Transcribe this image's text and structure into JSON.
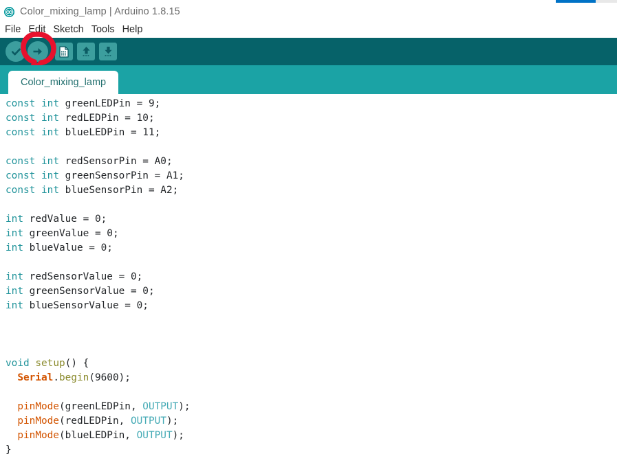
{
  "window": {
    "title": "Color_mixing_lamp | Arduino 1.8.15",
    "logo_icon": "arduino-infinity-icon"
  },
  "menu": {
    "items": [
      {
        "label": "File"
      },
      {
        "label": "Edit"
      },
      {
        "label": "Sketch"
      },
      {
        "label": "Tools"
      },
      {
        "label": "Help"
      }
    ]
  },
  "toolbar": {
    "buttons": [
      {
        "name": "verify",
        "label": "Verify",
        "icon": "check-icon"
      },
      {
        "name": "upload",
        "label": "Upload",
        "icon": "right-arrow-icon"
      },
      {
        "name": "new",
        "label": "New",
        "icon": "document-icon"
      },
      {
        "name": "open",
        "label": "Open",
        "icon": "up-arrow-icon"
      },
      {
        "name": "save",
        "label": "Save",
        "icon": "down-arrow-icon"
      }
    ],
    "annotation": {
      "target": "upload",
      "shape": "hand-drawn-circle",
      "color": "#e8112d"
    }
  },
  "tabs": {
    "active": "Color_mixing_lamp",
    "items": [
      {
        "label": "Color_mixing_lamp",
        "active": true
      }
    ]
  },
  "editor": {
    "lines": [
      [
        {
          "t": "const",
          "c": "kw"
        },
        {
          "t": " ",
          "c": "plain"
        },
        {
          "t": "int",
          "c": "kw"
        },
        {
          "t": " greenLEDPin = 9;",
          "c": "plain"
        }
      ],
      [
        {
          "t": "const",
          "c": "kw"
        },
        {
          "t": " ",
          "c": "plain"
        },
        {
          "t": "int",
          "c": "kw"
        },
        {
          "t": " redLEDPin = 10;",
          "c": "plain"
        }
      ],
      [
        {
          "t": "const",
          "c": "kw"
        },
        {
          "t": " ",
          "c": "plain"
        },
        {
          "t": "int",
          "c": "kw"
        },
        {
          "t": " blueLEDPin = 11;",
          "c": "plain"
        }
      ],
      [],
      [
        {
          "t": "const",
          "c": "kw"
        },
        {
          "t": " ",
          "c": "plain"
        },
        {
          "t": "int",
          "c": "kw"
        },
        {
          "t": " redSensorPin = A0;",
          "c": "plain"
        }
      ],
      [
        {
          "t": "const",
          "c": "kw"
        },
        {
          "t": " ",
          "c": "plain"
        },
        {
          "t": "int",
          "c": "kw"
        },
        {
          "t": " greenSensorPin = A1;",
          "c": "plain"
        }
      ],
      [
        {
          "t": "const",
          "c": "kw"
        },
        {
          "t": " ",
          "c": "plain"
        },
        {
          "t": "int",
          "c": "kw"
        },
        {
          "t": " blueSensorPin = A2;",
          "c": "plain"
        }
      ],
      [],
      [
        {
          "t": "int",
          "c": "kw"
        },
        {
          "t": " redValue = 0;",
          "c": "plain"
        }
      ],
      [
        {
          "t": "int",
          "c": "kw"
        },
        {
          "t": " greenValue = 0;",
          "c": "plain"
        }
      ],
      [
        {
          "t": "int",
          "c": "kw"
        },
        {
          "t": " blueValue = 0;",
          "c": "plain"
        }
      ],
      [],
      [
        {
          "t": "int",
          "c": "kw"
        },
        {
          "t": " redSensorValue = 0;",
          "c": "plain"
        }
      ],
      [
        {
          "t": "int",
          "c": "kw"
        },
        {
          "t": " greenSensorValue = 0;",
          "c": "plain"
        }
      ],
      [
        {
          "t": "int",
          "c": "kw"
        },
        {
          "t": " blueSensorValue = 0;",
          "c": "plain"
        }
      ],
      [],
      [],
      [],
      [
        {
          "t": "void",
          "c": "kw"
        },
        {
          "t": " ",
          "c": "plain"
        },
        {
          "t": "setup",
          "c": "fn"
        },
        {
          "t": "() {",
          "c": "plain"
        }
      ],
      [
        {
          "t": "  ",
          "c": "plain"
        },
        {
          "t": "Serial",
          "c": "obj"
        },
        {
          "t": ".",
          "c": "plain"
        },
        {
          "t": "begin",
          "c": "fn"
        },
        {
          "t": "(9600);",
          "c": "plain"
        }
      ],
      [],
      [
        {
          "t": "  ",
          "c": "plain"
        },
        {
          "t": "pinMode",
          "c": "call"
        },
        {
          "t": "(greenLEDPin, ",
          "c": "plain"
        },
        {
          "t": "OUTPUT",
          "c": "constant"
        },
        {
          "t": ");",
          "c": "plain"
        }
      ],
      [
        {
          "t": "  ",
          "c": "plain"
        },
        {
          "t": "pinMode",
          "c": "call"
        },
        {
          "t": "(redLEDPin, ",
          "c": "plain"
        },
        {
          "t": "OUTPUT",
          "c": "constant"
        },
        {
          "t": ");",
          "c": "plain"
        }
      ],
      [
        {
          "t": "  ",
          "c": "plain"
        },
        {
          "t": "pinMode",
          "c": "call"
        },
        {
          "t": "(blueLEDPin, ",
          "c": "plain"
        },
        {
          "t": "OUTPUT",
          "c": "constant"
        },
        {
          "t": ");",
          "c": "plain"
        }
      ],
      [
        {
          "t": "}",
          "c": "plain"
        }
      ]
    ]
  },
  "colors": {
    "toolbar_bg": "#066269",
    "tabstrip_bg": "#1ba3a5",
    "icon_bg": "#3c9e9e",
    "icon_fg": "#066269",
    "annotation_red": "#e8112d",
    "tab_text": "#23706f",
    "keyword": "#22949b",
    "function": "#8a8a2c",
    "call": "#d35400",
    "constant": "#44aab5",
    "top_blue": "#0072c6",
    "top_gray": "#e8e8e8"
  }
}
